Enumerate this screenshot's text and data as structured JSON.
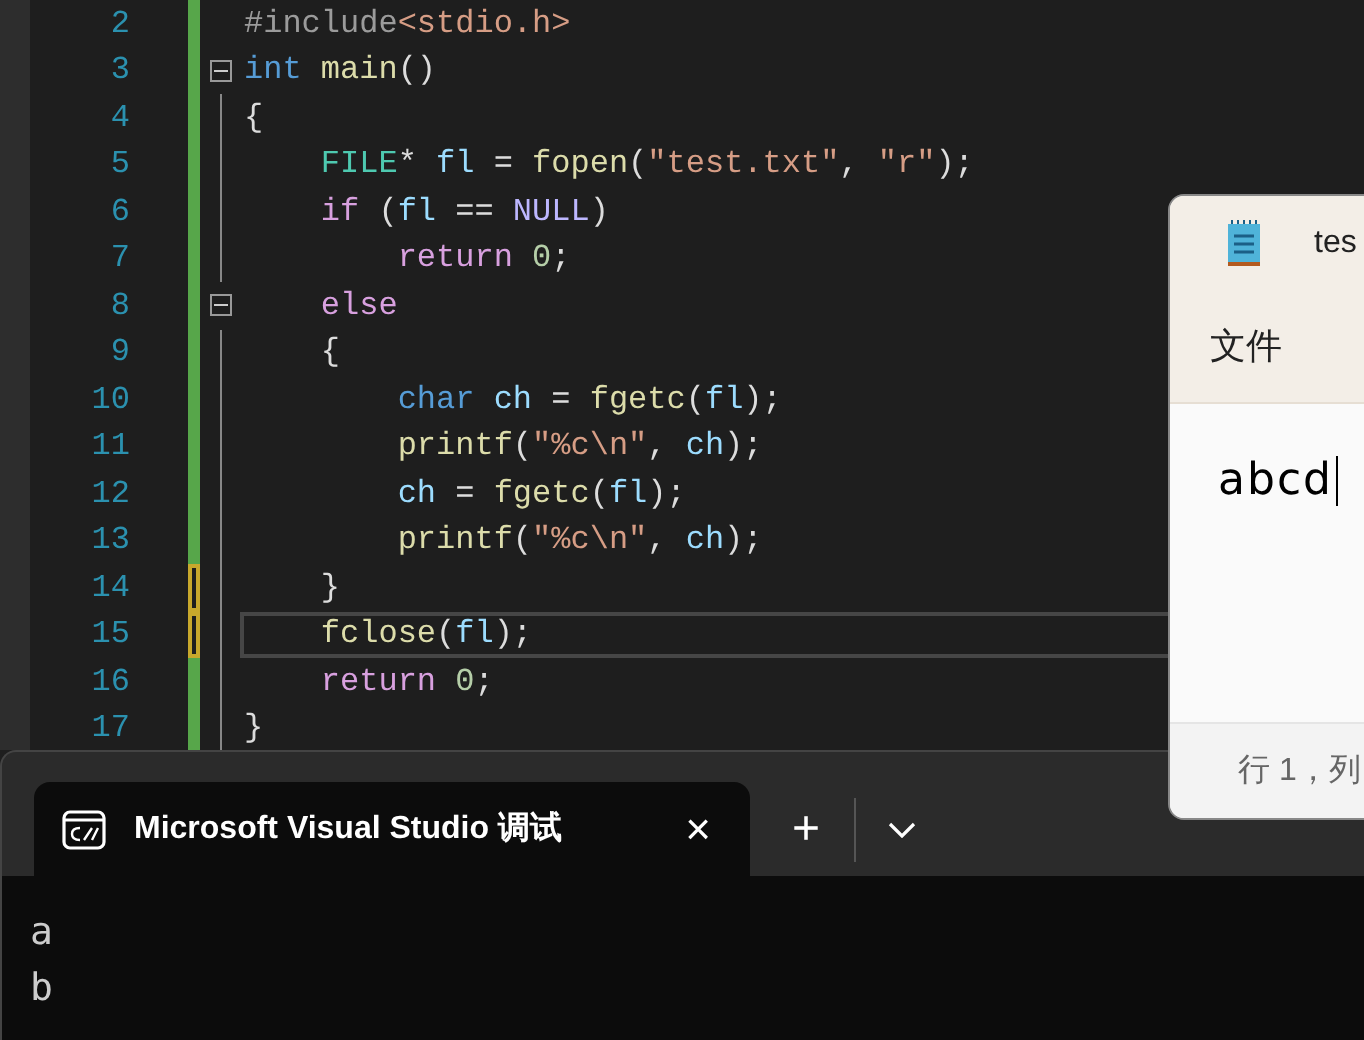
{
  "editor": {
    "lines": [
      {
        "number": "2",
        "collapsible": false,
        "modified": false,
        "selected": false,
        "tokens": [
          {
            "text": "#include",
            "kind": "pre"
          },
          {
            "text": "<stdio.h>",
            "kind": "str"
          }
        ]
      },
      {
        "number": "3",
        "collapsible": true,
        "modified": false,
        "selected": false,
        "tokens": [
          {
            "text": "int ",
            "kind": "kw"
          },
          {
            "text": "main",
            "kind": "fn"
          },
          {
            "text": "()",
            "kind": "plain"
          }
        ]
      },
      {
        "number": "4",
        "collapsible": false,
        "modified": false,
        "selected": false,
        "tokens": [
          {
            "text": "{",
            "kind": "plain"
          }
        ]
      },
      {
        "number": "5",
        "collapsible": false,
        "modified": false,
        "selected": false,
        "tokens": [
          {
            "text": "    FILE",
            "kind": "type"
          },
          {
            "text": "* ",
            "kind": "plain"
          },
          {
            "text": "fl",
            "kind": "var"
          },
          {
            "text": " = ",
            "kind": "plain"
          },
          {
            "text": "fopen",
            "kind": "fn"
          },
          {
            "text": "(",
            "kind": "plain"
          },
          {
            "text": "\"test.txt\"",
            "kind": "str"
          },
          {
            "text": ", ",
            "kind": "plain"
          },
          {
            "text": "\"r\"",
            "kind": "str"
          },
          {
            "text": ");",
            "kind": "plain"
          }
        ]
      },
      {
        "number": "6",
        "collapsible": false,
        "modified": false,
        "selected": false,
        "tokens": [
          {
            "text": "    if",
            "kind": "ctl"
          },
          {
            "text": " (",
            "kind": "plain"
          },
          {
            "text": "fl",
            "kind": "var"
          },
          {
            "text": " == ",
            "kind": "plain"
          },
          {
            "text": "NULL",
            "kind": "macro"
          },
          {
            "text": ")",
            "kind": "plain"
          }
        ]
      },
      {
        "number": "7",
        "collapsible": false,
        "modified": false,
        "selected": false,
        "tokens": [
          {
            "text": "        return ",
            "kind": "ctl"
          },
          {
            "text": "0",
            "kind": "num"
          },
          {
            "text": ";",
            "kind": "plain"
          }
        ]
      },
      {
        "number": "8",
        "collapsible": true,
        "modified": false,
        "selected": false,
        "tokens": [
          {
            "text": "    else",
            "kind": "ctl"
          }
        ]
      },
      {
        "number": "9",
        "collapsible": false,
        "modified": false,
        "selected": false,
        "tokens": [
          {
            "text": "    {",
            "kind": "plain"
          }
        ]
      },
      {
        "number": "10",
        "collapsible": false,
        "modified": false,
        "selected": false,
        "tokens": [
          {
            "text": "        char ",
            "kind": "kw"
          },
          {
            "text": "ch",
            "kind": "var"
          },
          {
            "text": " = ",
            "kind": "plain"
          },
          {
            "text": "fgetc",
            "kind": "fn"
          },
          {
            "text": "(",
            "kind": "plain"
          },
          {
            "text": "fl",
            "kind": "var"
          },
          {
            "text": ");",
            "kind": "plain"
          }
        ]
      },
      {
        "number": "11",
        "collapsible": false,
        "modified": false,
        "selected": false,
        "tokens": [
          {
            "text": "        printf",
            "kind": "fn"
          },
          {
            "text": "(",
            "kind": "plain"
          },
          {
            "text": "\"%c\\n\"",
            "kind": "str"
          },
          {
            "text": ", ",
            "kind": "plain"
          },
          {
            "text": "ch",
            "kind": "var"
          },
          {
            "text": ");",
            "kind": "plain"
          }
        ]
      },
      {
        "number": "12",
        "collapsible": false,
        "modified": false,
        "selected": false,
        "tokens": [
          {
            "text": "        ch",
            "kind": "var"
          },
          {
            "text": " = ",
            "kind": "plain"
          },
          {
            "text": "fgetc",
            "kind": "fn"
          },
          {
            "text": "(",
            "kind": "plain"
          },
          {
            "text": "fl",
            "kind": "var"
          },
          {
            "text": ");",
            "kind": "plain"
          }
        ]
      },
      {
        "number": "13",
        "collapsible": false,
        "modified": false,
        "selected": false,
        "tokens": [
          {
            "text": "        printf",
            "kind": "fn"
          },
          {
            "text": "(",
            "kind": "plain"
          },
          {
            "text": "\"%c\\n\"",
            "kind": "str"
          },
          {
            "text": ", ",
            "kind": "plain"
          },
          {
            "text": "ch",
            "kind": "var"
          },
          {
            "text": ");",
            "kind": "plain"
          }
        ]
      },
      {
        "number": "14",
        "collapsible": false,
        "modified": true,
        "selected": false,
        "tokens": [
          {
            "text": "    }",
            "kind": "plain"
          }
        ]
      },
      {
        "number": "15",
        "collapsible": false,
        "modified": true,
        "selected": true,
        "tokens": [
          {
            "text": "    fclose",
            "kind": "fn"
          },
          {
            "text": "(",
            "kind": "plain"
          },
          {
            "text": "fl",
            "kind": "var"
          },
          {
            "text": ");",
            "kind": "plain"
          }
        ]
      },
      {
        "number": "16",
        "collapsible": false,
        "modified": false,
        "selected": false,
        "tokens": [
          {
            "text": "    return ",
            "kind": "ctl"
          },
          {
            "text": "0",
            "kind": "num"
          },
          {
            "text": ";",
            "kind": "plain"
          }
        ]
      },
      {
        "number": "17",
        "collapsible": false,
        "modified": false,
        "selected": false,
        "tokens": [
          {
            "text": "}",
            "kind": "plain"
          }
        ]
      }
    ]
  },
  "notepad": {
    "title": "tes",
    "menu": [
      "文件"
    ],
    "content": "abcd",
    "status": "行 1，列"
  },
  "terminal": {
    "tab": {
      "title": "Microsoft Visual Studio 调试",
      "close": "×",
      "selected": true
    },
    "new_tab": "+",
    "output": [
      "a",
      "b"
    ]
  }
}
